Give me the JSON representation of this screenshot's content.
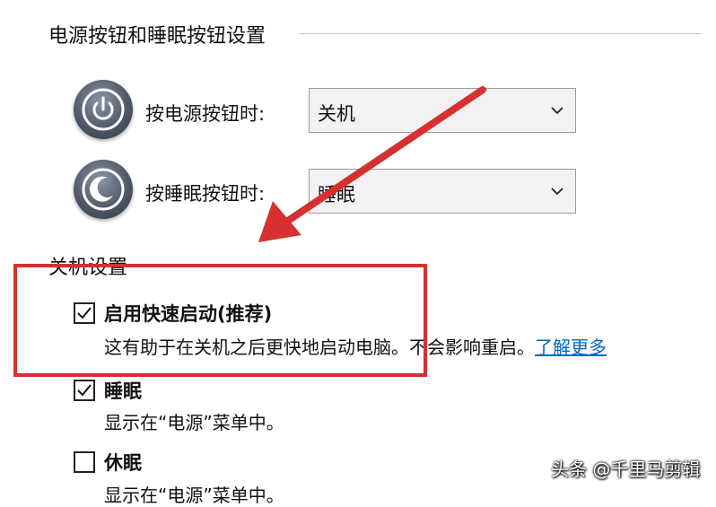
{
  "power_buttons": {
    "header": "电源按钮和睡眠按钮设置",
    "power_row": {
      "label": "按电源按钮时:",
      "value": "关机",
      "icon": "power-icon"
    },
    "sleep_row": {
      "label": "按睡眠按钮时:",
      "value": "睡眠",
      "icon": "sleep-icon"
    }
  },
  "shutdown": {
    "header": "关机设置",
    "options": [
      {
        "title": "启用快速启动(推荐)",
        "checked": true,
        "description": "这有助于在关机之后更快地启动电脑。不会影响重启。",
        "link": "了解更多"
      },
      {
        "title": "睡眠",
        "checked": true,
        "description": "显示在“电源”菜单中。"
      },
      {
        "title": "休眠",
        "checked": false,
        "description": "显示在“电源”菜单中。"
      }
    ]
  },
  "annotation": {
    "highlight_color": "#d63031"
  },
  "watermark": {
    "text": "头条 @千里马剪辑"
  }
}
